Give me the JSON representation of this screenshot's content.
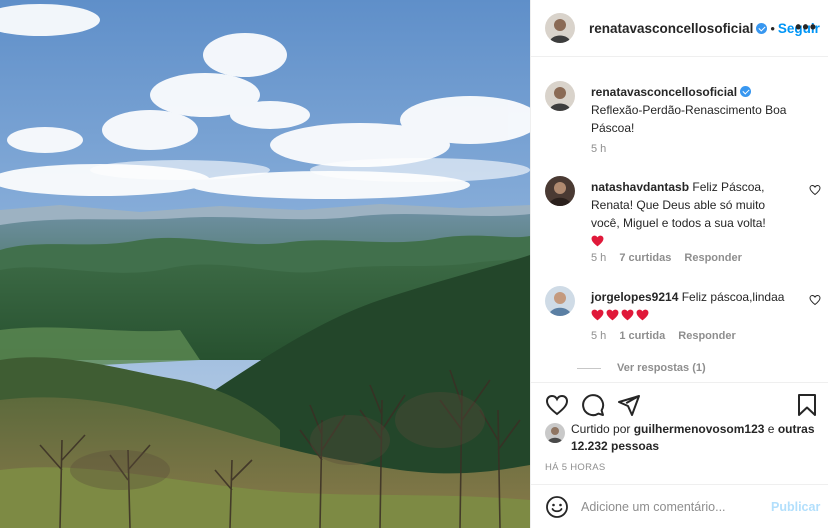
{
  "post": {
    "author": "renatavasconcellosoficial",
    "follow_label": "Seguir",
    "separator": "•",
    "more_label": "•••",
    "image_alt": "Vista de montanhas verdes sob céu azul com nuvens"
  },
  "caption": {
    "username": "renatavasconcellosoficial",
    "text": "Reflexão-Perdão-Renascimento Boa Páscoa!",
    "time": "5 h"
  },
  "comments": [
    {
      "username": "natashavdantasb",
      "text": "Feliz Páscoa, Renata! Que Deus able só muito você, Miguel e todos a sua volta!",
      "hearts": 1,
      "time": "5 h",
      "likes": "7 curtidas",
      "reply": "Responder"
    },
    {
      "username": "jorgelopes9214",
      "text": "Feliz páscoa,lindaa",
      "hearts": 4,
      "time": "5 h",
      "likes": "1 curtida",
      "reply": "Responder",
      "view_replies": "Ver respostas (1)"
    }
  ],
  "likes": {
    "prefix": "Curtido por",
    "user": "guilhermenovosom123",
    "joiner": "e",
    "others": "outras 12.232 pessoas"
  },
  "posted_ago": "HÁ 5 HORAS",
  "compose": {
    "placeholder": "Adicione um comentário...",
    "publish_label": "Publicar"
  },
  "icons": [
    "heart-icon",
    "comment-icon",
    "share-icon",
    "bookmark-icon",
    "emoji-icon",
    "verified-icon",
    "more-icon"
  ],
  "colors": {
    "accent": "#0095f6",
    "verified": "#3897f0",
    "muted": "#8e8e8e",
    "heart": "#ed4956"
  }
}
